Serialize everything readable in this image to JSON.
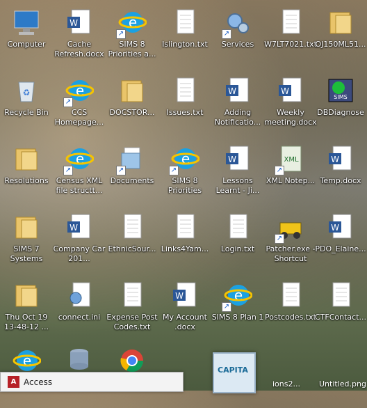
{
  "desktop": {
    "icons": [
      {
        "label": "Computer",
        "icon": "computer-icon",
        "shortcut": false
      },
      {
        "label": "Cache Refresh.docx",
        "icon": "word-doc-icon",
        "shortcut": false
      },
      {
        "label": "SIMS 8 Priorities a...",
        "icon": "internet-explorer-icon",
        "shortcut": true
      },
      {
        "label": "Islington.txt",
        "icon": "text-file-icon",
        "shortcut": false
      },
      {
        "label": "Services",
        "icon": "gears-icon",
        "shortcut": true
      },
      {
        "label": "W7LT7021.txt",
        "icon": "text-file-icon",
        "shortcut": false
      },
      {
        "label": "OJ150ML51...",
        "icon": "folder-icon",
        "shortcut": false
      },
      {
        "label": "Recycle Bin",
        "icon": "recycle-bin-icon",
        "shortcut": false
      },
      {
        "label": "CCS Homepage...",
        "icon": "internet-explorer-icon",
        "shortcut": true
      },
      {
        "label": "DOCSTOR...",
        "icon": "folder-icon",
        "shortcut": false
      },
      {
        "label": "Issues.txt",
        "icon": "text-file-icon",
        "shortcut": false
      },
      {
        "label": "Adding Notificatio...",
        "icon": "word-doc-icon",
        "shortcut": false
      },
      {
        "label": "Weekly meeting.docx",
        "icon": "word-doc-icon",
        "shortcut": false
      },
      {
        "label": "DBDiagnose",
        "icon": "sims-icon",
        "shortcut": false
      },
      {
        "label": "Resolutions",
        "icon": "folder-icon",
        "shortcut": false
      },
      {
        "label": "Census XML file structt...",
        "icon": "internet-explorer-icon",
        "shortcut": true
      },
      {
        "label": "Documents",
        "icon": "documents-icon",
        "shortcut": true
      },
      {
        "label": "SIMS 8 Priorities",
        "icon": "internet-explorer-icon",
        "shortcut": true
      },
      {
        "label": "Lessons Learnt - Ji...",
        "icon": "word-doc-icon",
        "shortcut": false
      },
      {
        "label": "XML Notep...",
        "icon": "xml-notepad-icon",
        "shortcut": true
      },
      {
        "label": "Temp.docx",
        "icon": "word-doc-icon",
        "shortcut": false
      },
      {
        "label": "SIMS 7 Systems",
        "icon": "folder-icon",
        "shortcut": false
      },
      {
        "label": "Company Car 201...",
        "icon": "word-doc-icon",
        "shortcut": false
      },
      {
        "label": "EthnicSour...",
        "icon": "text-file-icon",
        "shortcut": false
      },
      {
        "label": "Links4Yam...",
        "icon": "text-file-icon",
        "shortcut": false
      },
      {
        "label": "Login.txt",
        "icon": "text-file-icon",
        "shortcut": false
      },
      {
        "label": "Patcher.exe - Shortcut",
        "icon": "patcher-icon",
        "shortcut": true
      },
      {
        "label": "PDO_Elaine...",
        "icon": "word-doc-icon",
        "shortcut": false
      },
      {
        "label": "Thu Oct 19 13-48-12 ...",
        "icon": "folder-icon",
        "shortcut": false
      },
      {
        "label": "connect.ini",
        "icon": "config-file-icon",
        "shortcut": false
      },
      {
        "label": "Expense Post Codes.txt",
        "icon": "text-file-icon",
        "shortcut": false
      },
      {
        "label": "My Account .docx",
        "icon": "word-doc-icon",
        "shortcut": false
      },
      {
        "label": "SIMS 8 Plan 1",
        "icon": "internet-explorer-icon",
        "shortcut": true
      },
      {
        "label": "Postcodes.txt",
        "icon": "text-file-icon",
        "shortcut": false
      },
      {
        "label": "CTFContact...",
        "icon": "text-file-icon",
        "shortcut": false
      }
    ],
    "partial_bottom_row": [
      {
        "icon": "internet-explorer-icon"
      },
      {
        "icon": "database-icon"
      },
      {
        "icon": "chrome-icon"
      }
    ],
    "bottom_partial_labels": [
      {
        "label": "ions2..."
      },
      {
        "label": "Untitled.png"
      }
    ]
  },
  "taskbar_popup": {
    "app_name": "Access",
    "thumbnail_text": "CAPITA"
  },
  "colors": {
    "word": "#2b5797",
    "ie": "#1ba1e2",
    "folder": "#e9c46a",
    "access": "#b62026"
  }
}
